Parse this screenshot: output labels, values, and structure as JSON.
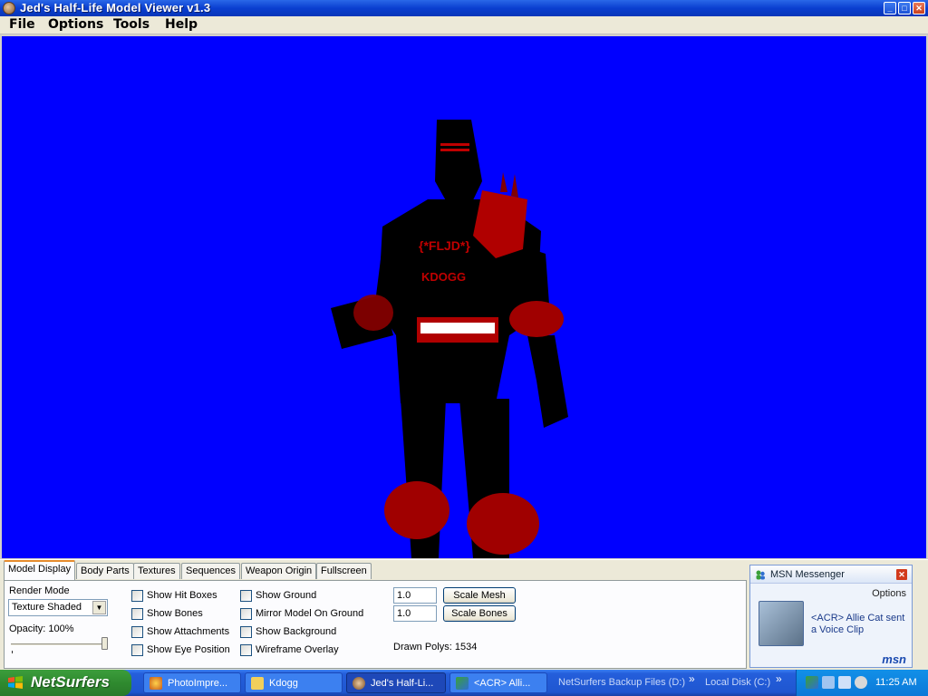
{
  "window": {
    "title": "Jed's Half-Life Model Viewer v1.3",
    "controls": {
      "minimize": "_",
      "maximize": "□",
      "close": "✕"
    }
  },
  "menu": [
    "File",
    "Options",
    "Tools",
    "Help"
  ],
  "viewport": {
    "background_color": "#0000ff",
    "model_chest_text": "{*FLJD*}",
    "model_name_text": "KDOGG"
  },
  "tabs": [
    "Model Display",
    "Body Parts",
    "Textures",
    "Sequences",
    "Weapon Origin",
    "Fullscreen"
  ],
  "active_tab": "Model Display",
  "model_display": {
    "render_mode_label": "Render Mode",
    "render_mode_value": "Texture Shaded",
    "opacity_label": "Opacity: 100%",
    "opacity_value": 1.0,
    "checkboxes_col1": [
      "Show Hit Boxes",
      "Show Bones",
      "Show Attachments",
      "Show Eye Position"
    ],
    "checkboxes_col2": [
      "Show Ground",
      "Mirror Model On Ground",
      "Show Background",
      "Wireframe Overlay"
    ],
    "scale_mesh_value": "1.0",
    "scale_mesh_button": "Scale Mesh",
    "scale_bones_value": "1.0",
    "scale_bones_button": "Scale Bones",
    "drawn_polys": "Drawn Polys: 1534"
  },
  "notification": {
    "title": "MSN Messenger",
    "options": "Options",
    "message": "<ACR> Allie Cat sent a Voice Clip",
    "logo": "msn"
  },
  "taskbar": {
    "start_label": "NetSurfers",
    "tasks": [
      "PhotoImpre...",
      "Kdogg",
      "Jed's Half-Li...",
      "<ACR> Alli..."
    ],
    "quick_links": [
      "NetSurfers Backup Files (D:)",
      "Local Disk (C:)"
    ],
    "chevron": "»",
    "clock": "11:25 AM"
  }
}
